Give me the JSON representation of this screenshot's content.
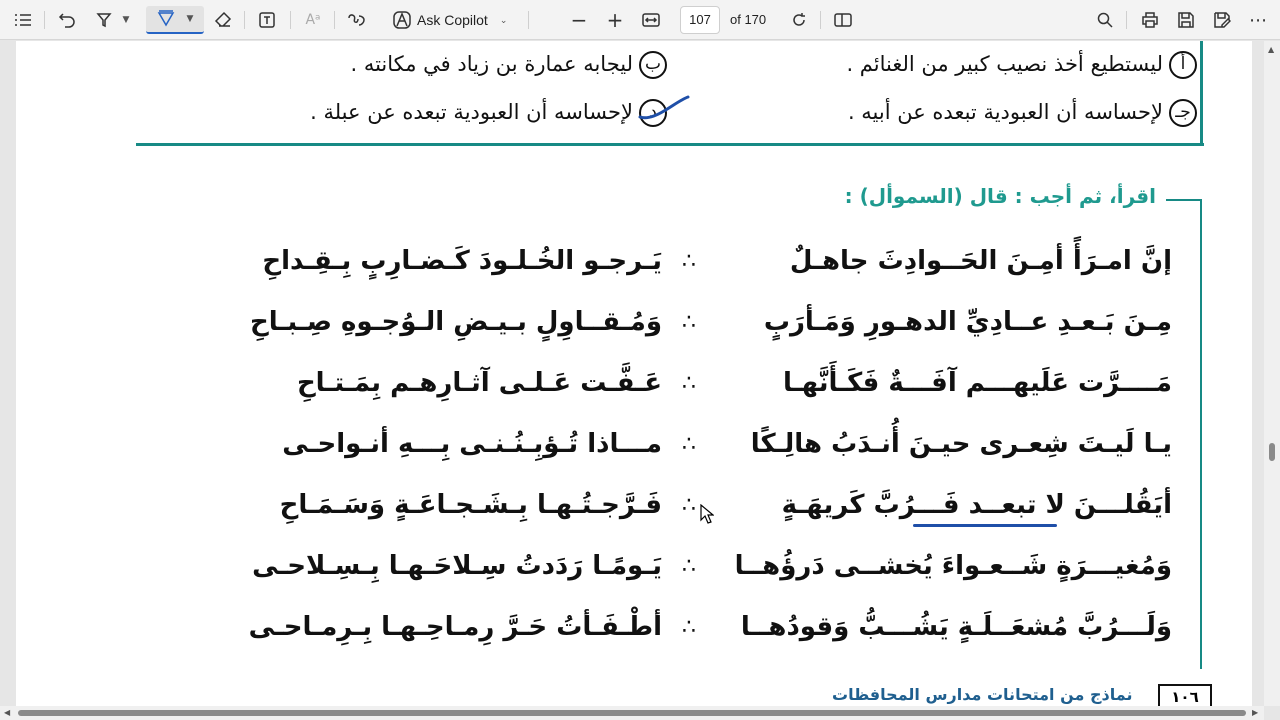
{
  "toolbar": {
    "ask_copilot": "Ask Copilot",
    "page_current": "107",
    "page_of": "of 170"
  },
  "document": {
    "answers": {
      "a": "ليستطيع أخذ نصيب كبير من الغنائم .",
      "a_marker": "أ",
      "b": "ليجابه عمارة بن زياد في مكانته .",
      "b_marker": "ب",
      "c": "لإحساسه أن العبودية تبعده عن أبيه .",
      "c_marker": "جـ",
      "d": "لإحساسه أن العبودية تبعده عن عبلة .",
      "d_marker": "د"
    },
    "section_heading": "اقرأ، ثم أجب : قال (السموأل) :",
    "separator": "∴",
    "verses": [
      {
        "right": "إنَّ امـرَأً أمِـنَ الحَــوادِثَ جاهـلٌ",
        "left": "يَـرجـو الخُـلـودَ كَـضـارِبٍ بِـقِـداحِ"
      },
      {
        "right": "مِـنَ بَـعـدِ عــادِيِّ الدهـورِ وَمَـأرَبٍ",
        "left": "وَمُـقــاوِلٍ بـيـضِ الـوُجـوهِ صِـبـاحِ"
      },
      {
        "right": "مَــــرَّت عَلَيهـــم آفَـــةٌ فَكَـأَنَّهـا",
        "left": "عَـفَّـت عَـلـى آثـارِهـم بِمَـتـاحِ"
      },
      {
        "right": "يـا لَيـتَ شِعـرى حيـنَ أُنـدَبُ هالِـكًا",
        "left": "مـــاذا تُـؤبِـنُـنـى بِـــهِ أنـواحـى"
      },
      {
        "right": "أيَقُلـــنَ لا تبعــد فَـــرُبَّ كَريهَـةٍ",
        "left": "فَـرَّجـتُـهـا بِـشَـجـاعَـةٍ وَسَـمَـاحِ"
      },
      {
        "right": "وَمُغيـــرَةٍ شَــعـواءَ يُخشــى دَرؤُهــا",
        "left": "يَـومًـا رَدَدتُ سِـلاحَـهـا بِـسِـلاحـى"
      },
      {
        "right": "وَلَـــرُبَّ مُشعَــلَـةٍ يَشُـــبُّ وَقودُهــا",
        "left": "أطْـفَـأتُ حَـرَّ رِمـاحِـهـا بِـرِمـاحـى"
      }
    ],
    "footer_text": "نماذج من امتحانات مدارس المحافظات",
    "footer_page": "١٠٦"
  },
  "colors": {
    "teal": "#178a85",
    "heading": "#1f9a8f",
    "ink_blue": "#1f4fa8"
  }
}
